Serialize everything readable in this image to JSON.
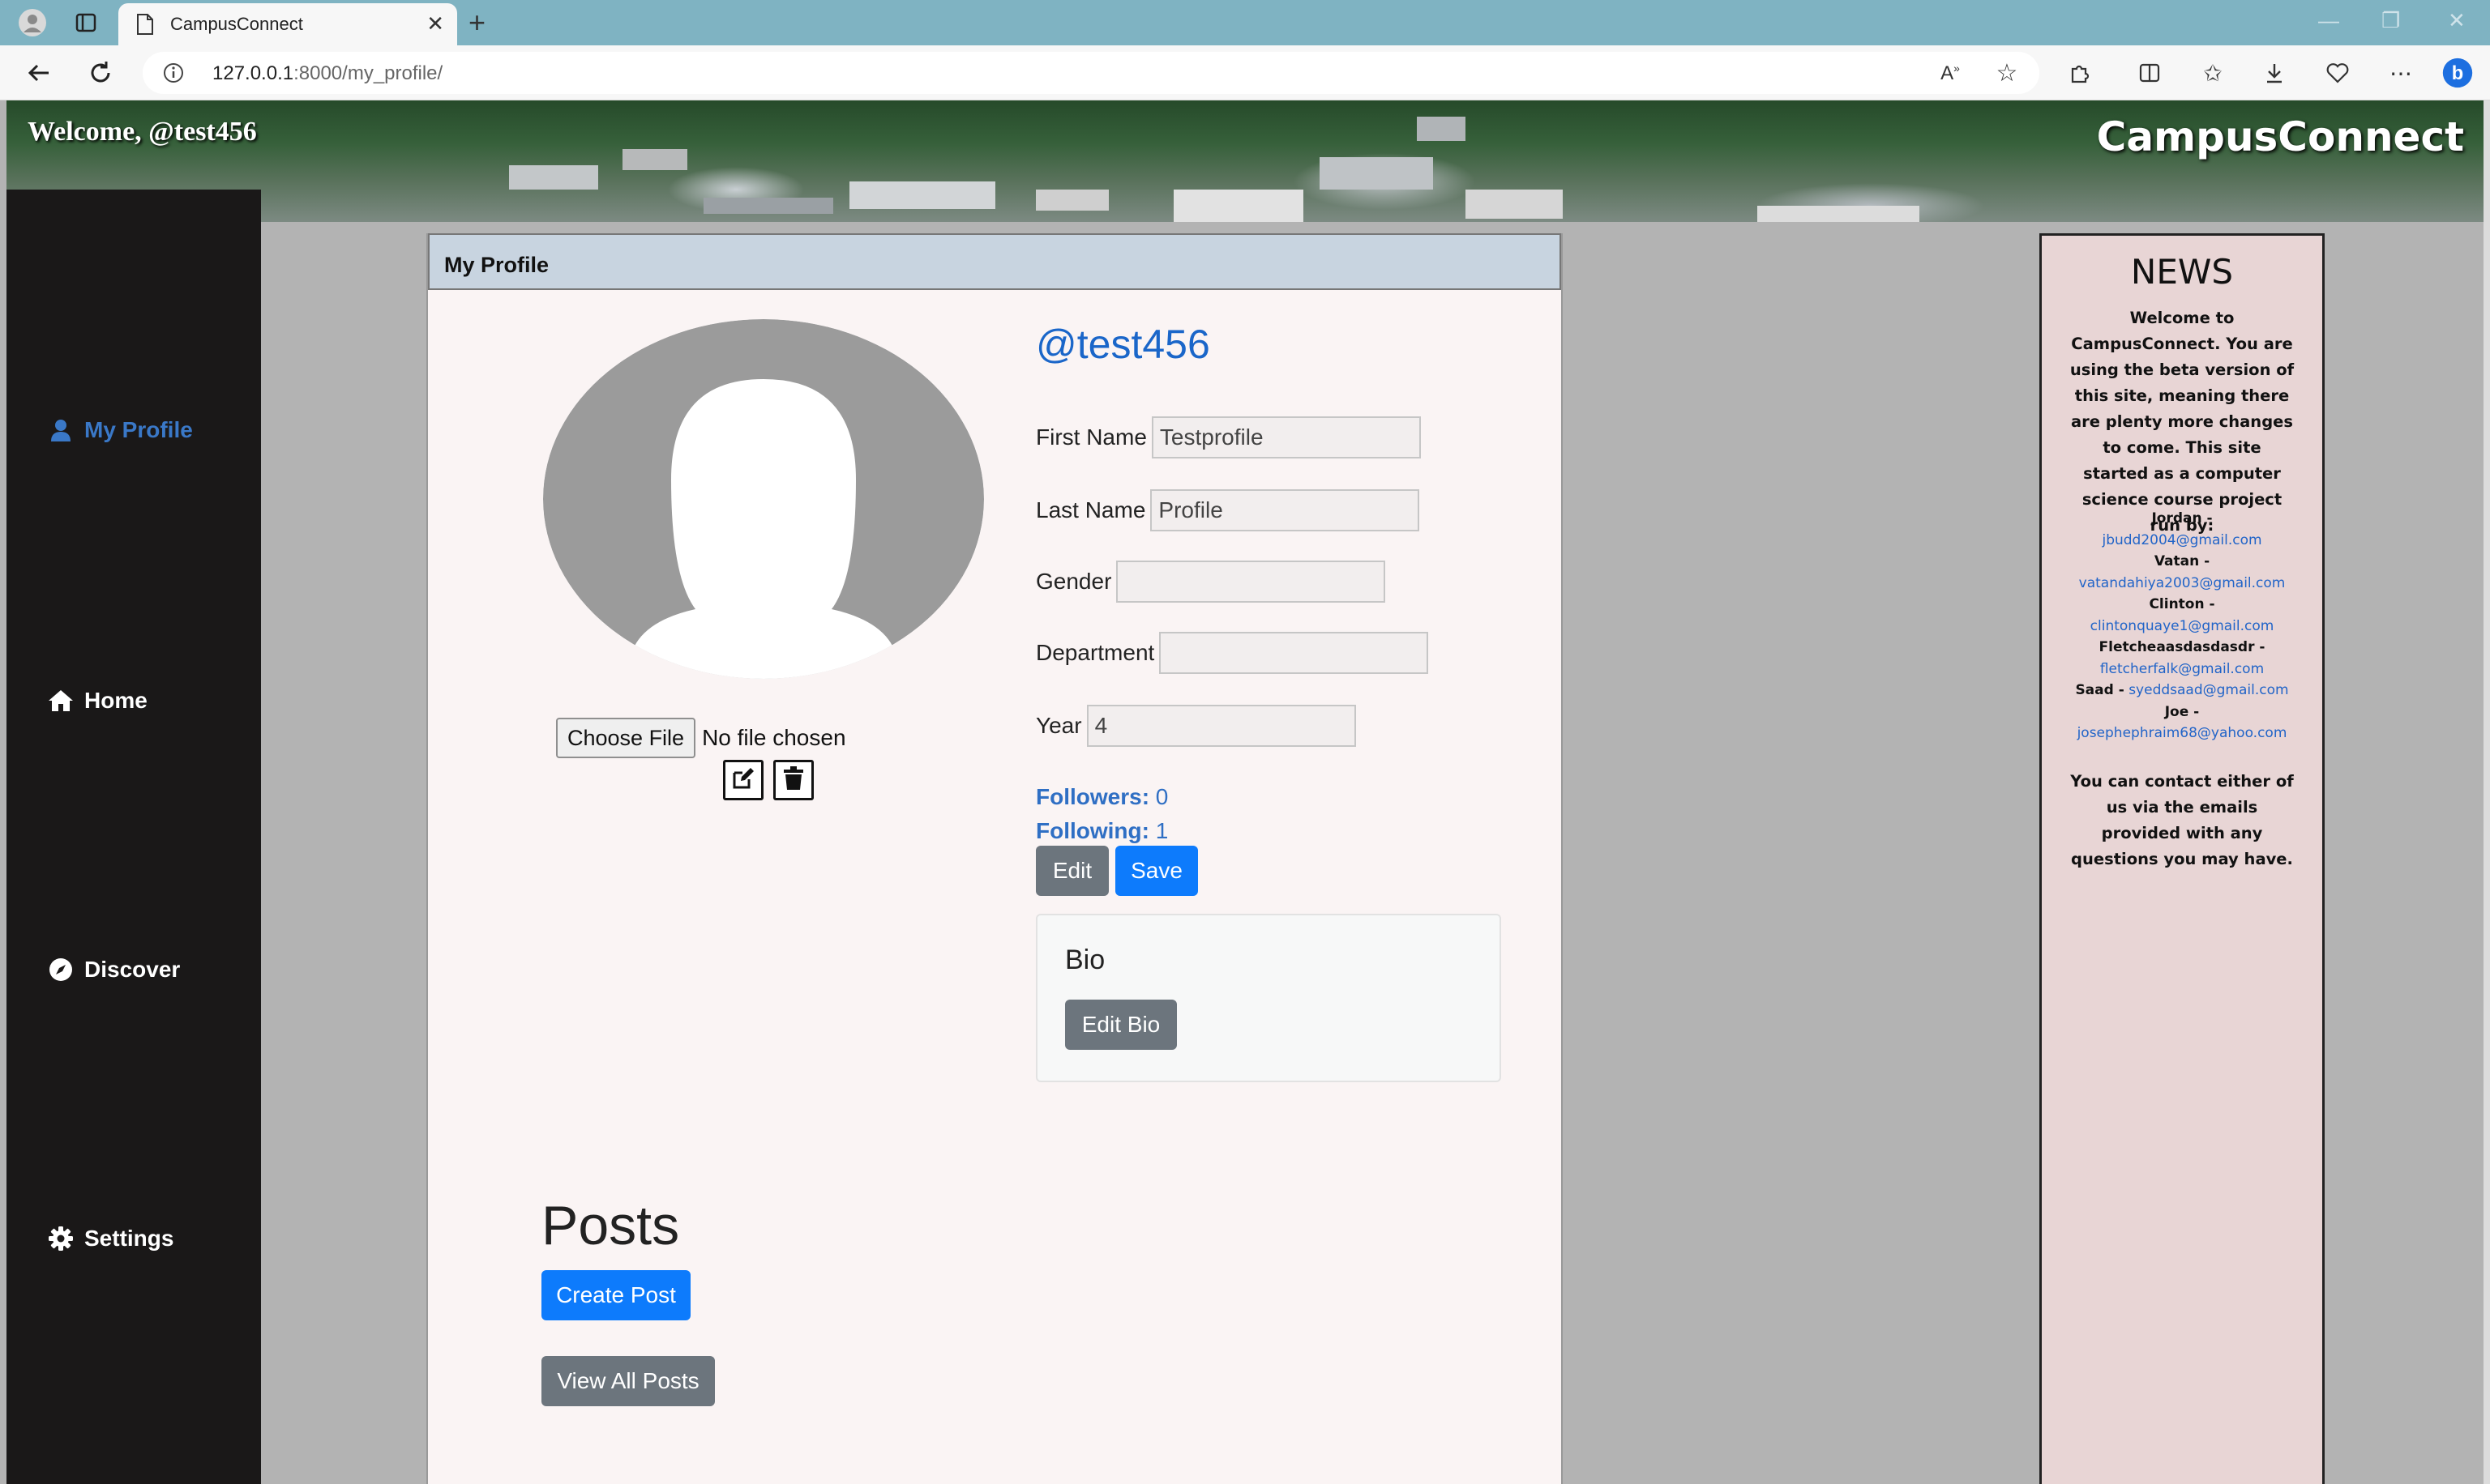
{
  "browser": {
    "tab_title": "CampusConnect",
    "url_host": "127.0.0.1",
    "url_path": ":8000/my_profile/"
  },
  "header": {
    "welcome": "Welcome, @test456",
    "brand": "CampusConnect"
  },
  "sidebar": {
    "items": [
      {
        "label": "My Profile",
        "icon": "user-icon",
        "active": true
      },
      {
        "label": "Home",
        "icon": "home-icon"
      },
      {
        "label": "Discover",
        "icon": "compass-icon"
      },
      {
        "label": "Settings",
        "icon": "gear-icon"
      }
    ]
  },
  "profile": {
    "card_title": "My Profile",
    "username": "@test456",
    "choose_file": "Choose File",
    "no_file": "No file chosen",
    "fields": {
      "first_name": {
        "label": "First Name",
        "value": "Testprofile"
      },
      "last_name": {
        "label": "Last Name",
        "value": "Profile"
      },
      "gender": {
        "label": "Gender",
        "value": ""
      },
      "department": {
        "label": "Department",
        "value": ""
      },
      "year": {
        "label": "Year",
        "value": "4"
      }
    },
    "followers_label": "Followers:",
    "followers_count": "0",
    "following_label": "Following:",
    "following_count": "1",
    "edit_label": "Edit",
    "save_label": "Save",
    "bio_title": "Bio",
    "edit_bio_label": "Edit Bio",
    "posts_title": "Posts",
    "create_post_label": "Create Post",
    "view_all_posts_label": "View All Posts"
  },
  "news": {
    "title": "NEWS",
    "body": "Welcome to CampusConnect. You are using the beta version of this site, meaning there are plenty more changes to come. This site started as a computer science course project run by:",
    "contacts": [
      {
        "name": "Jordan -",
        "email": "jbudd2004@gmail.com"
      },
      {
        "name": "Vatan -",
        "email": "vatandahiya2003@gmail.com"
      },
      {
        "name": "Clinton -",
        "email": "clintonquaye1@gmail.com"
      },
      {
        "name": "Fletcheaasdasdasdr -",
        "email": "fletcherfalk@gmail.com"
      },
      {
        "name": "Saad -",
        "email": "syeddsaad@gmail.com"
      },
      {
        "name": "Joe -",
        "email": "josephephraim68@yahoo.com"
      }
    ],
    "footer": "You can contact either of us via the emails provided with any questions you may have."
  },
  "colors": {
    "accent_blue": "#0d7bfc",
    "link_blue": "#1a66c9",
    "sidebar_bg": "#1a1818",
    "news_bg": "#e8d5d5"
  }
}
